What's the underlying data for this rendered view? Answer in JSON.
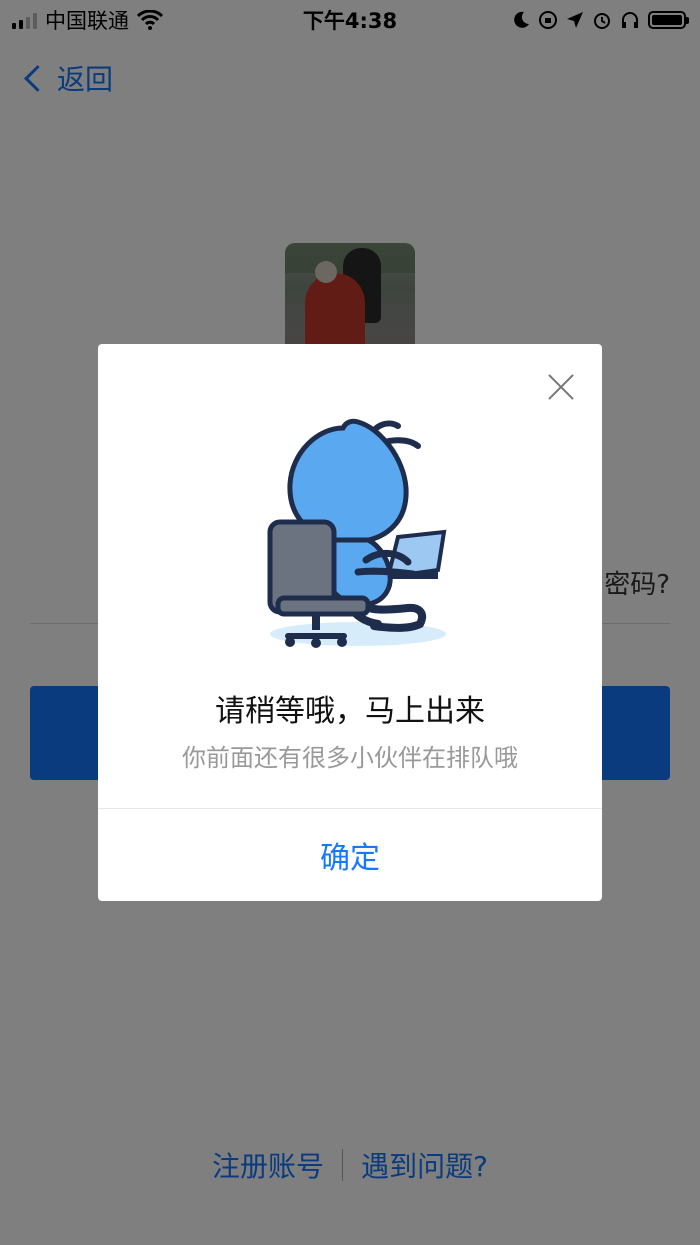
{
  "status_bar": {
    "carrier": "中国联通",
    "time": "下午4:38"
  },
  "nav": {
    "back_label": "返回"
  },
  "login": {
    "forgot_password": "密码?"
  },
  "footer": {
    "register": "注册账号",
    "problem": "遇到问题?"
  },
  "dialog": {
    "title": "请稍等哦，马上出来",
    "subtitle": "你前面还有很多小伙伴在排队哦",
    "confirm": "确定"
  },
  "colors": {
    "accent": "#1677ff",
    "overlay": "rgba(0,0,0,0.5)"
  },
  "icons": {
    "back": "chevron-left-icon",
    "close": "close-icon",
    "wifi": "wifi-icon",
    "signal": "signal-icon",
    "moon": "moon-icon",
    "location": "location-icon",
    "alarm": "alarm-icon",
    "headphones": "headphones-icon",
    "battery": "battery-icon"
  }
}
